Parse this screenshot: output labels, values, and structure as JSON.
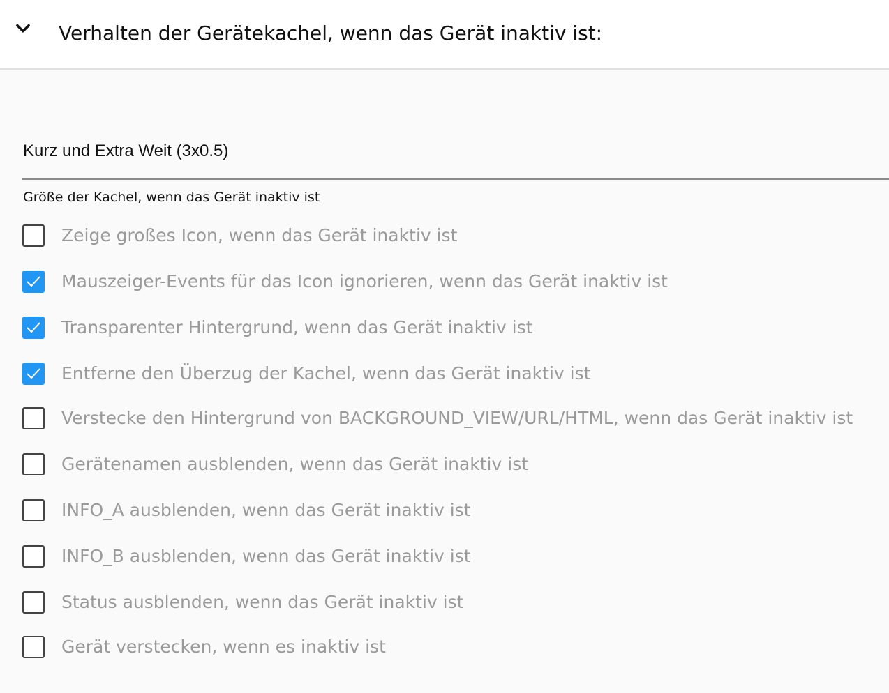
{
  "header": {
    "title": "Verhalten der Gerätekachel, wenn das Gerät inaktiv ist:",
    "toggle_icon": "chevron-down-icon"
  },
  "size_select": {
    "value": "Kurz und Extra Weit (3x0.5)",
    "helper": "Größe der Kachel, wenn das Gerät inaktiv ist"
  },
  "options": [
    {
      "label": "Zeige großes Icon, wenn das Gerät inaktiv ist",
      "checked": false
    },
    {
      "label": "Mauszeiger-Events für das Icon ignorieren, wenn das Gerät inaktiv ist",
      "checked": true
    },
    {
      "label": "Transparenter Hintergrund, wenn das Gerät inaktiv ist",
      "checked": true
    },
    {
      "label": "Entferne den Überzug der Kachel, wenn das Gerät inaktiv ist",
      "checked": true
    },
    {
      "label": "Verstecke den Hintergrund von BACKGROUND_VIEW/URL/HTML, wenn das Gerät inaktiv ist",
      "checked": false
    },
    {
      "label": "Gerätenamen ausblenden, wenn das Gerät inaktiv ist",
      "checked": false
    },
    {
      "label": "INFO_A ausblenden, wenn das Gerät inaktiv ist",
      "checked": false
    },
    {
      "label": "INFO_B ausblenden, wenn das Gerät inaktiv ist",
      "checked": false
    },
    {
      "label": "Status ausblenden, wenn das Gerät inaktiv ist",
      "checked": false
    },
    {
      "label": "Gerät verstecken, wenn es inaktiv ist",
      "checked": false
    }
  ],
  "colors": {
    "checkbox_checked": "#2196f3",
    "label_disabled": "#9a9a9a",
    "text": "#111111"
  }
}
